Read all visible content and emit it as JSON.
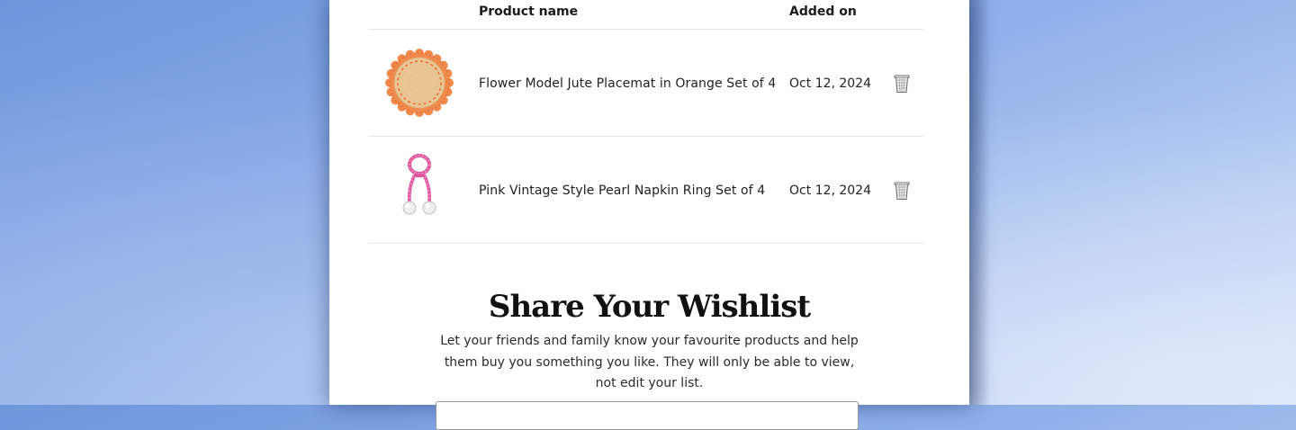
{
  "wishlist": {
    "columns": {
      "product_name": "Product name",
      "added_on": "Added on"
    },
    "items": [
      {
        "name": "Flower Model Jute Placemat in Orange Set of 4",
        "added_on": "Oct 12, 2024",
        "image": "orange-scalloped-jute-placemat",
        "remove_icon": "trash-icon"
      },
      {
        "name": "Pink Vintage Style Pearl Napkin Ring Set of 4",
        "added_on": "Oct 12, 2024",
        "image": "pink-pearl-napkin-ring",
        "remove_icon": "trash-icon"
      }
    ]
  },
  "share": {
    "title": "Share Your Wishlist",
    "description": "Let your friends and family know your favourite products and help them buy you something you like. They will only be able to view, not edit your list."
  },
  "colors": {
    "background_start": "#6f95dc",
    "background_end": "#d3e0f8",
    "card": "#ffffff",
    "placemat_orange": "#f08a4b",
    "napkin_ring_pink": "#e0529c"
  }
}
